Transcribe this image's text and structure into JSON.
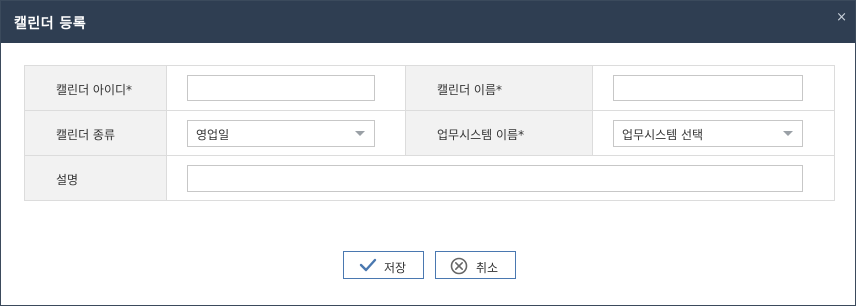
{
  "dialog": {
    "title": "캘린더 등록",
    "close_icon": "close-icon",
    "close_glyph": "×"
  },
  "form": {
    "calendar_id_label": "캘린더 아이디*",
    "calendar_id_value": "",
    "calendar_name_label": "캘린더 이름*",
    "calendar_name_value": "",
    "calendar_type_label": "캘린더 종류",
    "calendar_type_value": "영업일",
    "business_system_label": "업무시스템 이름*",
    "business_system_value": "업무시스템 선택",
    "description_label": "설명",
    "description_value": ""
  },
  "buttons": {
    "save_label": "저장",
    "save_icon": "checkmark-icon",
    "cancel_label": "취소",
    "cancel_icon": "cancel-circle-icon"
  },
  "colors": {
    "titlebar": "#2f3e52",
    "button_border": "#4a78b0",
    "icon_blue": "#4a78b0",
    "icon_gray": "#666666"
  }
}
